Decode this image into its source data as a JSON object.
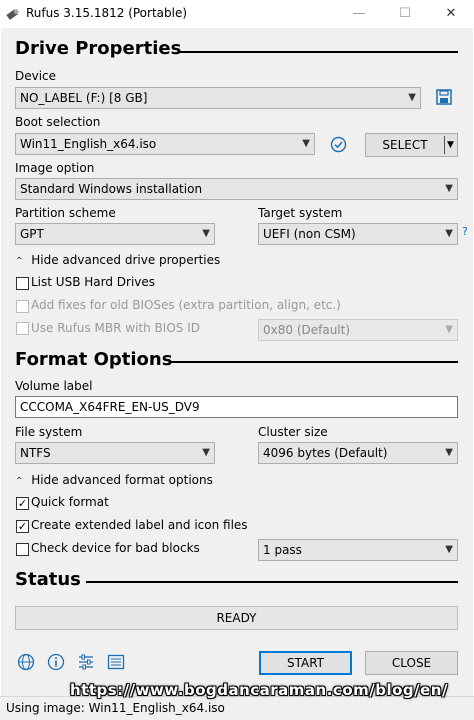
{
  "window": {
    "title": "Rufus 3.15.1812 (Portable)",
    "minimize": "—",
    "maximize": "☐",
    "close": "✕"
  },
  "drive_properties": {
    "title": "Drive Properties",
    "device_label": "Device",
    "device_value": "NO_LABEL (F:) [8 GB]",
    "boot_selection_label": "Boot selection",
    "boot_selection_value": "Win11_English_x64.iso",
    "select_button": "SELECT",
    "image_option_label": "Image option",
    "image_option_value": "Standard Windows installation",
    "partition_scheme_label": "Partition scheme",
    "partition_scheme_value": "GPT",
    "target_system_label": "Target system",
    "target_system_value": "UEFI (non CSM)",
    "target_help": "?",
    "advanced_toggle": "Hide advanced drive properties",
    "list_usb": "List USB Hard Drives",
    "add_fixes": "Add fixes for old BIOSes (extra partition, align, etc.)",
    "use_rufus_mbr": "Use Rufus MBR with BIOS ID",
    "bios_id_value": "0x80 (Default)"
  },
  "format_options": {
    "title": "Format Options",
    "volume_label_label": "Volume label",
    "volume_label_value": "CCCOMA_X64FRE_EN-US_DV9",
    "file_system_label": "File system",
    "file_system_value": "NTFS",
    "cluster_size_label": "Cluster size",
    "cluster_size_value": "4096 bytes (Default)",
    "advanced_toggle": "Hide advanced format options",
    "quick_format": "Quick format",
    "extended_label": "Create extended label and icon files",
    "check_bad_blocks": "Check device for bad blocks",
    "passes_value": "1 pass"
  },
  "status": {
    "title": "Status",
    "progress_text": "READY",
    "progress_fraction": 0
  },
  "actions": {
    "start": "START",
    "close": "CLOSE"
  },
  "icons": {
    "save": "save-icon",
    "check": "check-circle-icon",
    "globe": "globe-icon",
    "info": "info-icon",
    "settings": "settings-sliders-icon",
    "log": "log-icon"
  },
  "status_bar": {
    "text": "Using image: Win11_English_x64.iso"
  },
  "watermark": {
    "text": "https://www.bogdancaraman.com/blog/en/"
  },
  "colors": {
    "accent": "#0078d7",
    "icon_blue": "#1e6fb0"
  }
}
